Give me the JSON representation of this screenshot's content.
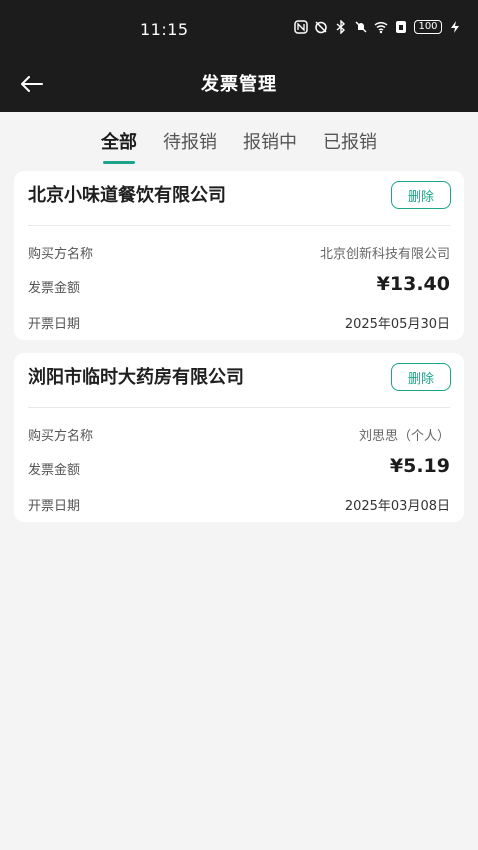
{
  "status_bar": {
    "time": "11:15",
    "battery": "100",
    "icons": [
      "nfc-icon",
      "alarm-off-icon",
      "bluetooth-icon",
      "mute-icon",
      "wifi-icon",
      "sim-icon",
      "battery-icon",
      "charging-icon"
    ]
  },
  "nav": {
    "title": "发票管理",
    "back_icon": "back-arrow-icon"
  },
  "tabs": [
    {
      "label": "全部",
      "active": true
    },
    {
      "label": "待报销",
      "active": false
    },
    {
      "label": "报销中",
      "active": false
    },
    {
      "label": "已报销",
      "active": false
    }
  ],
  "invoices": [
    {
      "company": "北京小味道餐饮有限公司",
      "delete_label": "删除",
      "buyer_label": "购买方名称",
      "buyer": "北京创新科技有限公司",
      "amount_label": "发票金额",
      "amount": "¥13.40",
      "date_label": "开票日期",
      "date": "2025年05月30日"
    },
    {
      "company": "浏阳市临时大药房有限公司",
      "delete_label": "删除",
      "buyer_label": "购买方名称",
      "buyer": "刘思思（个人）",
      "amount_label": "发票金额",
      "amount": "¥5.19",
      "date_label": "开票日期",
      "date": "2025年03月08日"
    }
  ],
  "colors": {
    "accent": "#1ba48a",
    "header_bg": "#1c1c1c",
    "page_bg": "#f3f4f3"
  }
}
